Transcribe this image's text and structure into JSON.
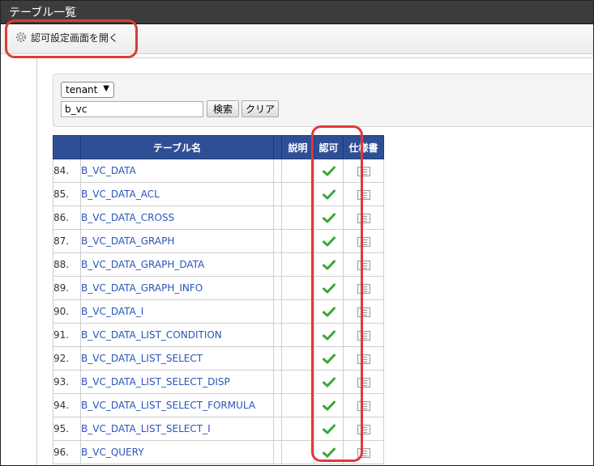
{
  "window": {
    "title": "テーブル一覧"
  },
  "toolbar": {
    "open_permission_label": "認可設定画面を開く"
  },
  "search": {
    "tenant_select": "tenant",
    "query_value": "b_vc",
    "search_button": "検索",
    "clear_button": "クリア"
  },
  "table": {
    "headers": {
      "num": "",
      "name": "テーブル名",
      "desc": "説明",
      "perm": "認可",
      "spec": "仕様書"
    },
    "rows": [
      {
        "num": "84.",
        "name": "B_VC_DATA"
      },
      {
        "num": "85.",
        "name": "B_VC_DATA_ACL"
      },
      {
        "num": "86.",
        "name": "B_VC_DATA_CROSS"
      },
      {
        "num": "87.",
        "name": "B_VC_DATA_GRAPH"
      },
      {
        "num": "88.",
        "name": "B_VC_DATA_GRAPH_DATA"
      },
      {
        "num": "89.",
        "name": "B_VC_DATA_GRAPH_INFO"
      },
      {
        "num": "90.",
        "name": "B_VC_DATA_I"
      },
      {
        "num": "91.",
        "name": "B_VC_DATA_LIST_CONDITION"
      },
      {
        "num": "92.",
        "name": "B_VC_DATA_LIST_SELECT"
      },
      {
        "num": "93.",
        "name": "B_VC_DATA_LIST_SELECT_DISP"
      },
      {
        "num": "94.",
        "name": "B_VC_DATA_LIST_SELECT_FORMULA"
      },
      {
        "num": "95.",
        "name": "B_VC_DATA_LIST_SELECT_I"
      },
      {
        "num": "96.",
        "name": "B_VC_QUERY"
      }
    ]
  },
  "colors": {
    "header_bg": "#2f4f95",
    "link": "#2a55b8",
    "check": "#3aa63a",
    "callout": "#e0393a"
  },
  "icons": {
    "toolbar": "gear-icon",
    "permission": "check-icon",
    "spec": "document-icon",
    "select": "caret-down-icon"
  }
}
